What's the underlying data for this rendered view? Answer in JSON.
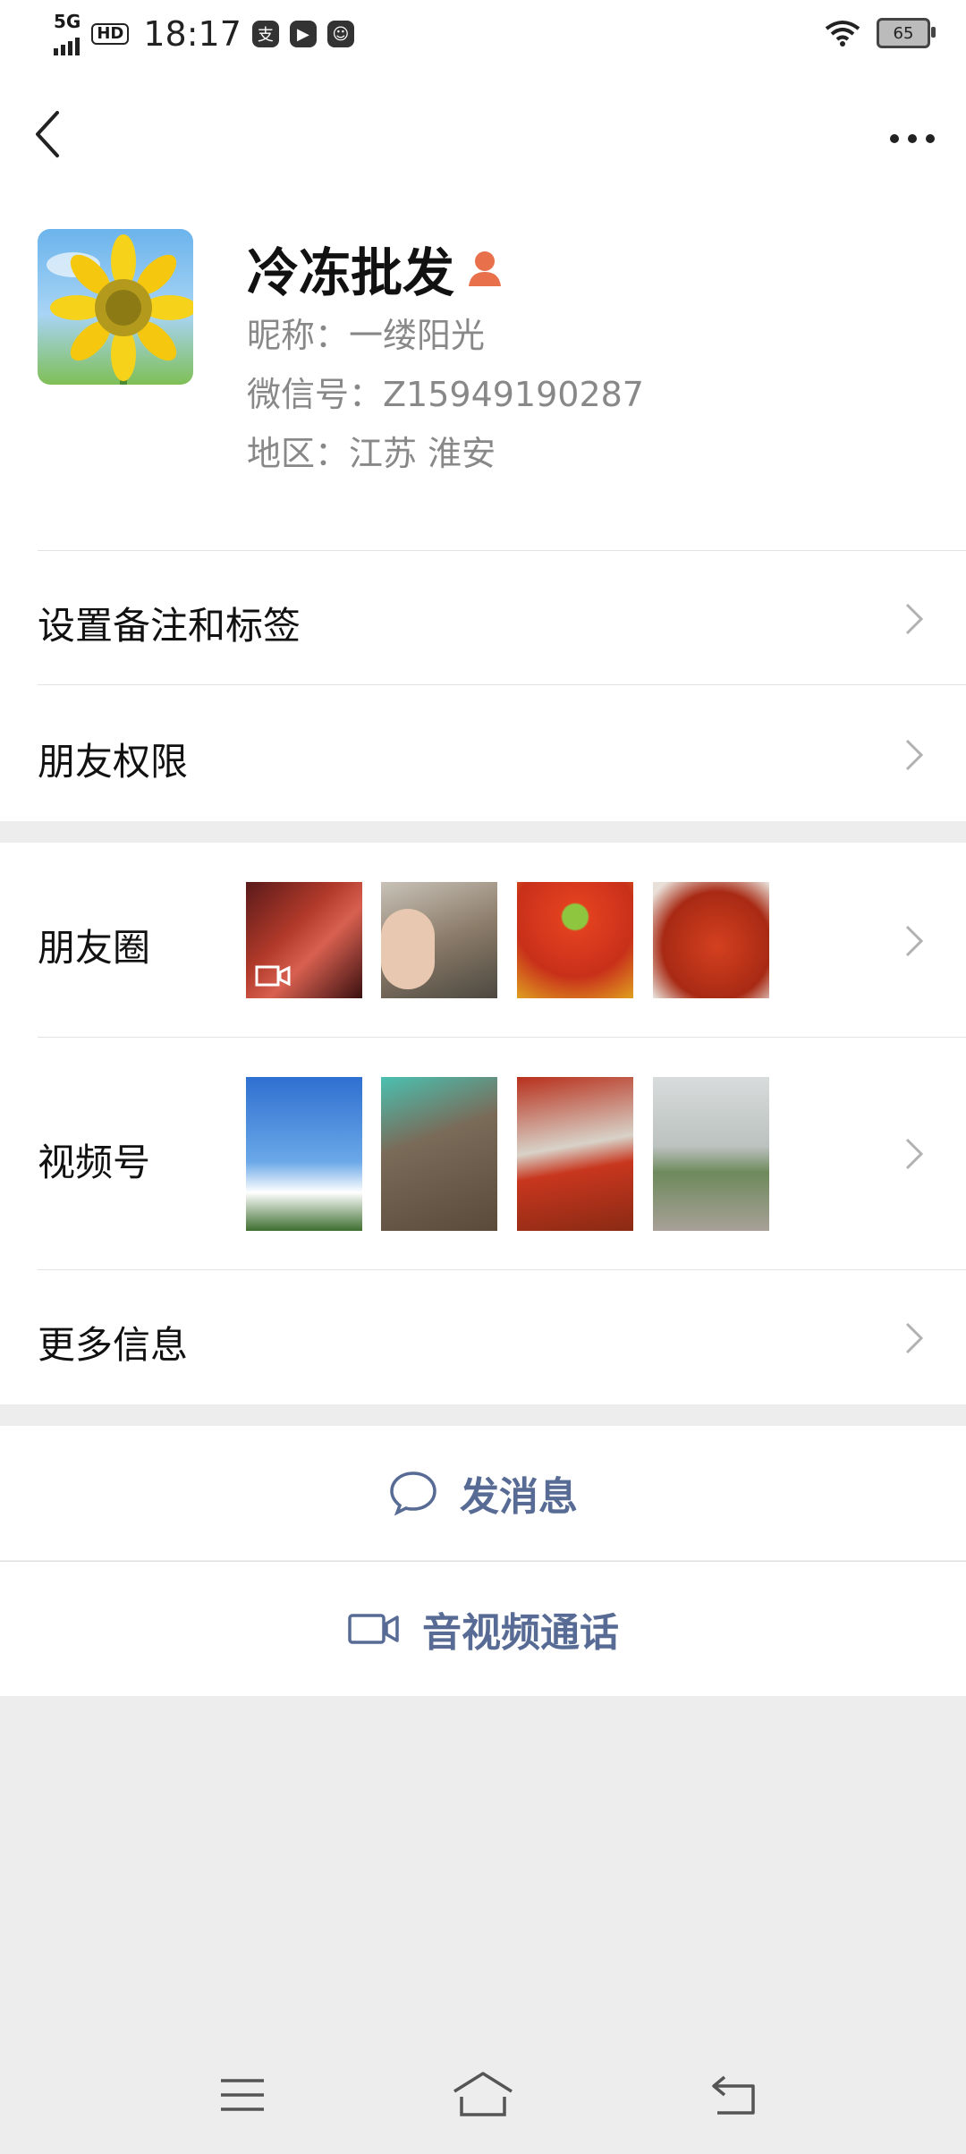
{
  "status_bar": {
    "network": "5G",
    "hd": "HD",
    "time": "18:17",
    "battery": "65",
    "app_icons": [
      "app-icon-1",
      "play-icon",
      "face-icon"
    ]
  },
  "profile": {
    "title": "冷冻批发",
    "nickname": "昵称：一缕阳光",
    "wechat_id": "微信号：Z15949190287",
    "region": "地区：江苏  淮安"
  },
  "menu": {
    "remark": "设置备注和标签",
    "permission": "朋友权限",
    "moments": "朋友圈",
    "channels": "视频号",
    "more_info": "更多信息"
  },
  "actions": {
    "message": "发消息",
    "call": "音视频通话"
  },
  "colors": {
    "accent": "#576b95",
    "background": "#ededed",
    "badge": "#e8704a"
  }
}
